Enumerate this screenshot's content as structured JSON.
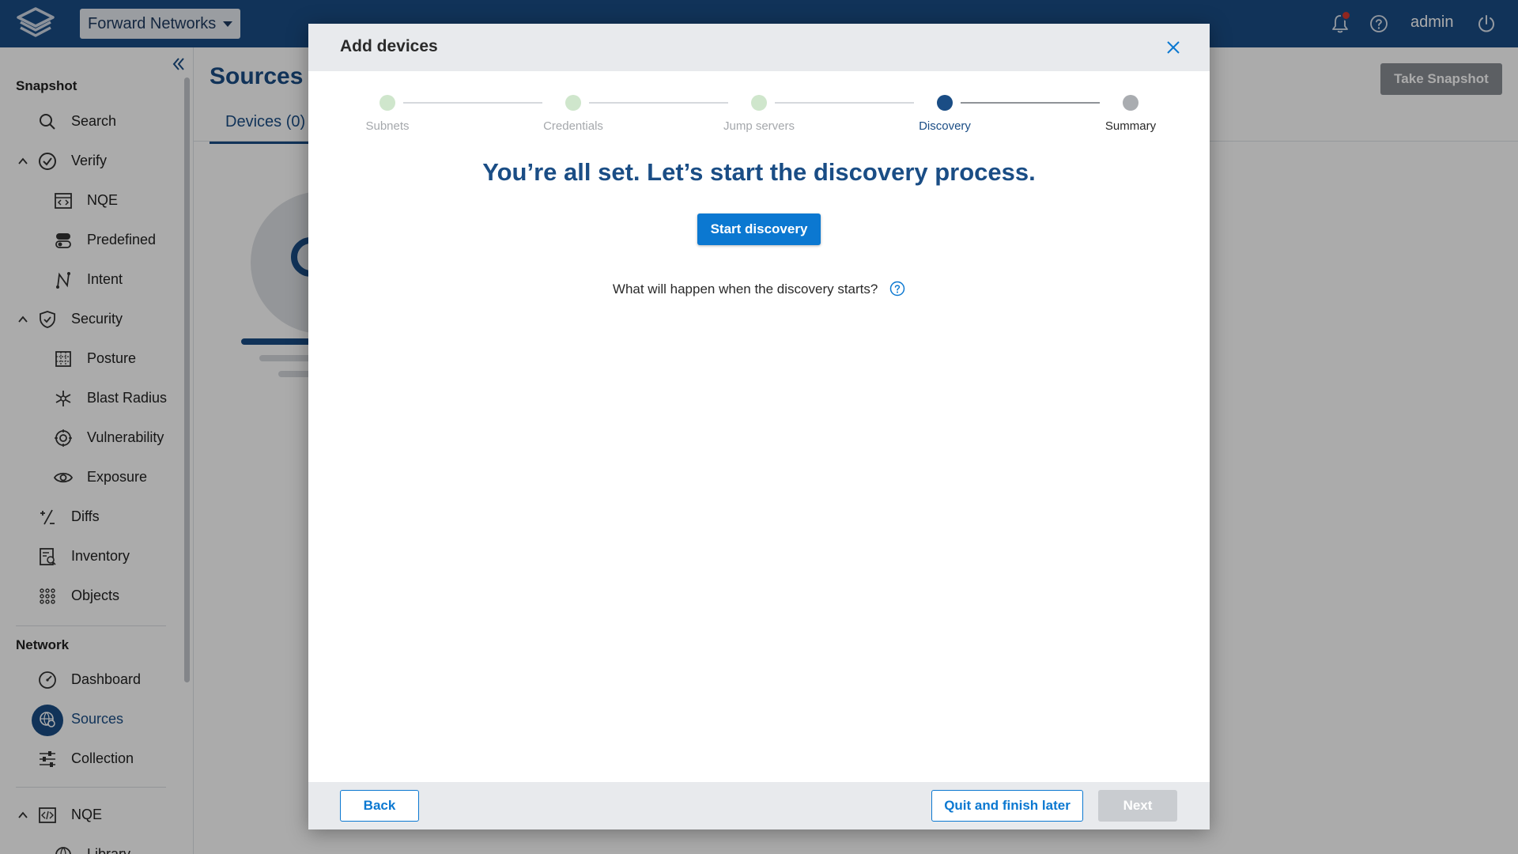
{
  "app": {
    "context_name": "Forward Networks",
    "user": "admin",
    "has_notification": true,
    "colors": {
      "topbar": "#1a4d85",
      "accent": "#0b78d1",
      "step_done": "#cfe6cc",
      "step_active": "#1a4d85",
      "step_pending": "#a9acb0"
    }
  },
  "sidebar": {
    "snapshot_title": "Snapshot",
    "network_title": "Network",
    "items": [
      {
        "label": "Search",
        "icon": "search-icon"
      },
      {
        "label": "Verify",
        "icon": "check-circle-icon",
        "expandable": true
      },
      {
        "label": "NQE",
        "icon": "code-window-icon"
      },
      {
        "label": "Predefined",
        "icon": "toggles-icon"
      },
      {
        "label": "Intent",
        "icon": "path-icon"
      },
      {
        "label": "Security",
        "icon": "shield-icon",
        "expandable": true
      },
      {
        "label": "Posture",
        "icon": "grid-icon"
      },
      {
        "label": "Blast Radius",
        "icon": "snowflake-icon"
      },
      {
        "label": "Vulnerability",
        "icon": "target-icon"
      },
      {
        "label": "Exposure",
        "icon": "eye-icon"
      },
      {
        "label": "Diffs",
        "icon": "plus-minus-icon"
      },
      {
        "label": "Inventory",
        "icon": "inventory-icon"
      },
      {
        "label": "Objects",
        "icon": "dots-grid-icon"
      },
      {
        "label": "Dashboard",
        "icon": "gauge-icon"
      },
      {
        "label": "Sources",
        "icon": "globe-gear-icon",
        "active": true
      },
      {
        "label": "Collection",
        "icon": "sliders-icon"
      },
      {
        "label": "NQE",
        "icon": "code-window-icon",
        "expandable": true
      },
      {
        "label": "Library",
        "icon": "globe-icon"
      }
    ]
  },
  "main": {
    "title": "Sources",
    "tab_label": "Devices (0)",
    "take_snapshot": "Take Snapshot"
  },
  "modal": {
    "title": "Add devices",
    "steps": [
      {
        "label": "Subnets",
        "state": "done"
      },
      {
        "label": "Credentials",
        "state": "done"
      },
      {
        "label": "Jump servers",
        "state": "done"
      },
      {
        "label": "Discovery",
        "state": "active"
      },
      {
        "label": "Summary",
        "state": "pending"
      }
    ],
    "headline": "You’re all set. Let’s start the discovery process.",
    "start_button": "Start discovery",
    "what_happens": "What will happen when the discovery starts?",
    "back_button": "Back",
    "quit_button": "Quit and finish later",
    "next_button": "Next"
  }
}
